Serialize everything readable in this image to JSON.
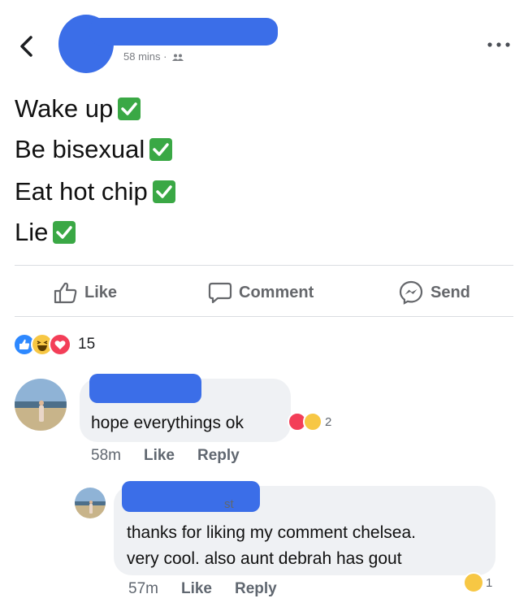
{
  "post": {
    "time": "58 mins",
    "privacy_icon": "friends-icon",
    "lines": [
      "Wake up",
      "Be bisexual",
      "Eat hot chip",
      "Lie"
    ]
  },
  "actions": {
    "like": "Like",
    "comment": "Comment",
    "send": "Send"
  },
  "reactions": {
    "count": "15",
    "types": [
      "like",
      "haha",
      "love"
    ]
  },
  "comments": [
    {
      "text": "hope everythings ok",
      "reaction_count": "2",
      "time": "58m",
      "like": "Like",
      "reply": "Reply"
    },
    {
      "name_fragment": "st",
      "text_line1": "thanks for liking my comment chelsea.",
      "text_line2": "very cool. also aunt debrah has gout",
      "reaction_count": "1",
      "time": "57m",
      "like": "Like",
      "reply": "Reply"
    }
  ],
  "colors": {
    "accent": "#3b6ee8",
    "check_green": "#3aa845",
    "like_blue": "#2d88ff",
    "love_red": "#f33e58",
    "haha_yellow": "#f7c744"
  }
}
